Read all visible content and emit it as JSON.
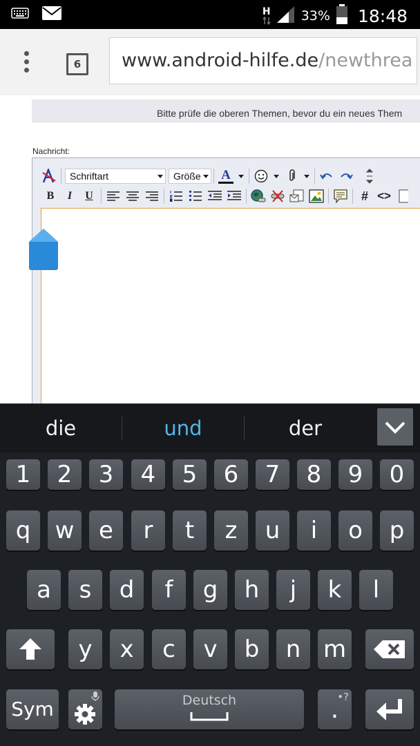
{
  "status_bar": {
    "network_type": "H",
    "battery_percent": "33%",
    "time": "18:48",
    "icons": [
      "keyboard-icon",
      "mail-icon",
      "data-arrows-icon",
      "signal-icon",
      "battery-icon"
    ]
  },
  "browser": {
    "tab_count": "6",
    "url_domain": "www.android-hilfe.de",
    "url_path": "/newthrea"
  },
  "page": {
    "notice": "Bitte prüfe die oberen Themen, bevor du ein neues Them",
    "message_label": "Nachricht:",
    "editor": {
      "font_select": "Schriftart",
      "size_select": "Größe"
    }
  },
  "keyboard": {
    "suggestions": [
      "die",
      "und",
      "der"
    ],
    "highlight_color": "#4fb7e8",
    "rows": {
      "numbers": [
        "1",
        "2",
        "3",
        "4",
        "5",
        "6",
        "7",
        "8",
        "9",
        "0"
      ],
      "row1": [
        "q",
        "w",
        "e",
        "r",
        "t",
        "z",
        "u",
        "i",
        "o",
        "p"
      ],
      "row2": [
        "a",
        "s",
        "d",
        "f",
        "g",
        "h",
        "j",
        "k",
        "l"
      ],
      "row3": [
        "y",
        "x",
        "c",
        "v",
        "b",
        "n",
        "m"
      ]
    },
    "sym_label": "Sym",
    "space_label": "Deutsch",
    "period_label": ".",
    "period_alt": "•?"
  }
}
